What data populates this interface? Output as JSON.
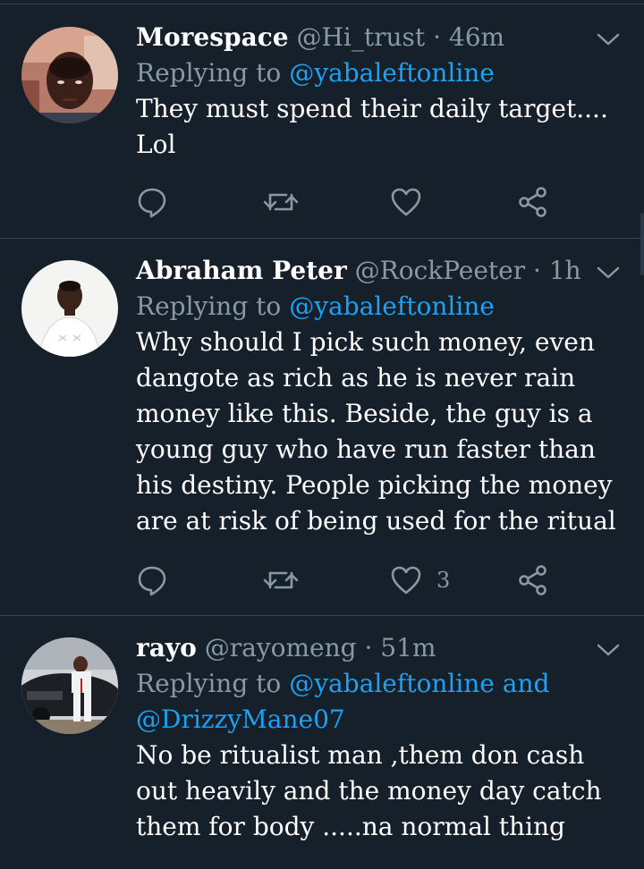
{
  "tweets": [
    {
      "display_name": "Morespace",
      "handle": "@Hi_trust",
      "time": "· 46m",
      "replying_prefix": "Replying to",
      "mentions": "@yabaleftonline",
      "mentions_2": "",
      "text": "They must spend their daily target.... Lol",
      "like_count": "",
      "avatar": "person-photo"
    },
    {
      "display_name": "Abraham Peter",
      "handle": "@RockPeeter",
      "time": "· 1h",
      "replying_prefix": "Replying to",
      "mentions": "@yabaleftonline",
      "mentions_2": "",
      "text": "Why should I pick such money, even dangote as rich as he is never rain money like this. Beside, the guy is a young guy who have run faster than his destiny. People picking the money are at risk of being used for the ritual",
      "like_count": "3",
      "avatar": "person-photo"
    },
    {
      "display_name": "rayo",
      "handle": "@rayomeng",
      "time": "· 51m",
      "replying_prefix": "Replying to",
      "mentions": "@yabaleftonline and",
      "mentions_2": "@DrizzyMane07",
      "text": "No be ritualist man ,them don cash out heavily and the money day catch them for body .....na normal thing",
      "like_count": "",
      "avatar": "person-with-car-photo"
    }
  ],
  "icons": {
    "reply": "reply-icon",
    "retweet": "retweet-icon",
    "like": "heart-icon",
    "share": "share-icon",
    "more": "chevron-down-icon"
  },
  "colors": {
    "background": "#15202b",
    "divider": "#38444d",
    "secondary_text": "#8899a6",
    "link": "#1da1f2",
    "primary_text": "#ffffff"
  }
}
